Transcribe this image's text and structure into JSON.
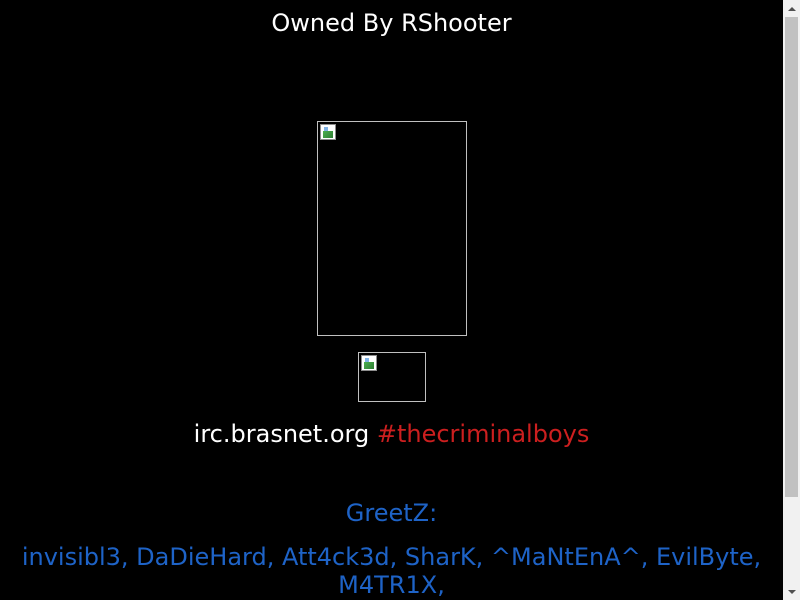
{
  "page": {
    "title": "Owned By RShooter",
    "irc": {
      "server": "irc.brasnet.org",
      "channel": "#thecriminalboys"
    },
    "greetz": {
      "title": "GreetZ:",
      "names": "invisibl3, DaDieHard, Att4ck3d, SharK, ^MaNtEnA^, EvilByte, M4TR1X,"
    }
  },
  "images": {
    "main": {
      "icon": "broken-image-icon"
    },
    "small": {
      "icon": "broken-image-icon"
    }
  },
  "colors": {
    "background": "#000000",
    "title": "#ffffff",
    "irc_server": "#ffffff",
    "irc_channel": "#cc1f1f",
    "greetz": "#1e63c7"
  },
  "scrollbar": {
    "up_icon": "scroll-up-arrow-icon",
    "down_icon": "scroll-down-arrow-icon"
  }
}
